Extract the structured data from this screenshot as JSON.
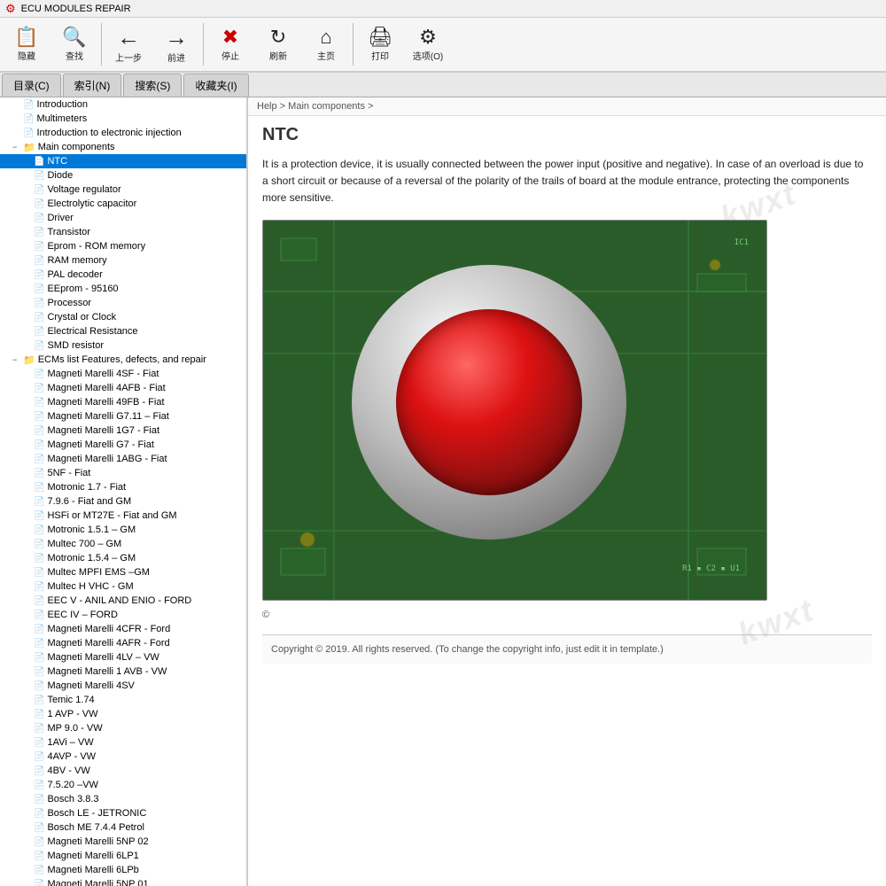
{
  "titleBar": {
    "icon": "⚙",
    "title": "ECU MODULES REPAIR"
  },
  "toolbar": {
    "buttons": [
      {
        "label": "隐藏",
        "icon": "📄",
        "name": "hide-button"
      },
      {
        "label": "查找",
        "icon": "🔍",
        "name": "find-button"
      },
      {
        "label": "上一步",
        "icon": "←",
        "name": "back-button"
      },
      {
        "label": "前进",
        "icon": "→",
        "name": "forward-button"
      },
      {
        "label": "停止",
        "icon": "✖",
        "name": "stop-button"
      },
      {
        "label": "刷新",
        "icon": "🔄",
        "name": "refresh-button"
      },
      {
        "label": "主页",
        "icon": "🏠",
        "name": "home-button"
      },
      {
        "label": "打印",
        "icon": "🖨",
        "name": "print-button"
      },
      {
        "label": "选项(O)",
        "icon": "⚙",
        "name": "options-button"
      }
    ]
  },
  "tabs": [
    {
      "label": "目录(C)",
      "active": false
    },
    {
      "label": "索引(N)",
      "active": false
    },
    {
      "label": "搜索(S)",
      "active": false
    },
    {
      "label": "收藏夹(I)",
      "active": false
    }
  ],
  "breadcrumb": "Help > Main components >",
  "pageTitle": "NTC",
  "contentText": "It is a protection device, it is usually connected between the power input (positive and negative). In case of an overload is due to a short circuit or because of a reversal of the polarity of the trails of board at the module entrance, protecting the components more sensitive.",
  "copyright": "©",
  "footerCopyright": "Copyright © 2019. All rights reserved. (To change the copyright info, just edit it in template.)",
  "watermark": "kwxt",
  "sidebar": {
    "items": [
      {
        "level": 1,
        "label": "Introduction",
        "type": "doc",
        "expand": "",
        "name": "introduction"
      },
      {
        "level": 1,
        "label": "Multimeters",
        "type": "doc",
        "expand": "",
        "name": "multimeters"
      },
      {
        "level": 1,
        "label": "Introduction to electronic injection",
        "type": "doc",
        "expand": "",
        "name": "intro-electronic"
      },
      {
        "level": 1,
        "label": "Main components",
        "type": "folder",
        "expand": "−",
        "name": "main-components"
      },
      {
        "level": 2,
        "label": "NTC",
        "type": "doc",
        "expand": "",
        "name": "ntc",
        "selected": true
      },
      {
        "level": 2,
        "label": "Diode",
        "type": "doc",
        "expand": "",
        "name": "diode"
      },
      {
        "level": 2,
        "label": "Voltage regulator",
        "type": "doc",
        "expand": "",
        "name": "voltage-regulator"
      },
      {
        "level": 2,
        "label": "Electrolytic capacitor",
        "type": "doc",
        "expand": "",
        "name": "electrolytic-capacitor"
      },
      {
        "level": 2,
        "label": "Driver",
        "type": "doc",
        "expand": "",
        "name": "driver"
      },
      {
        "level": 2,
        "label": "Transistor",
        "type": "doc",
        "expand": "",
        "name": "transistor"
      },
      {
        "level": 2,
        "label": "Eprom - ROM memory",
        "type": "doc",
        "expand": "",
        "name": "eprom-rom"
      },
      {
        "level": 2,
        "label": "RAM memory",
        "type": "doc",
        "expand": "",
        "name": "ram-memory"
      },
      {
        "level": 2,
        "label": "PAL decoder",
        "type": "doc",
        "expand": "",
        "name": "pal-decoder"
      },
      {
        "level": 2,
        "label": "EEprom - 95160",
        "type": "doc",
        "expand": "",
        "name": "eeprom-95160"
      },
      {
        "level": 2,
        "label": "Processor",
        "type": "doc",
        "expand": "",
        "name": "processor"
      },
      {
        "level": 2,
        "label": "Crystal or Clock",
        "type": "doc",
        "expand": "",
        "name": "crystal-clock"
      },
      {
        "level": 2,
        "label": "Electrical Resistance",
        "type": "doc",
        "expand": "",
        "name": "electrical-resistance"
      },
      {
        "level": 2,
        "label": "SMD resistor",
        "type": "doc",
        "expand": "",
        "name": "smd-resistor"
      },
      {
        "level": 1,
        "label": "ECMs list Features, defects, and repair",
        "type": "folder",
        "expand": "−",
        "name": "ecms-list"
      },
      {
        "level": 2,
        "label": "Magneti Marelli 4SF - Fiat",
        "type": "doc",
        "expand": "",
        "name": "mm-4sf-fiat"
      },
      {
        "level": 2,
        "label": "Magneti Marelli 4AFB - Fiat",
        "type": "doc",
        "expand": "",
        "name": "mm-4afb"
      },
      {
        "level": 2,
        "label": "Magneti Marelli 49FB - Fiat",
        "type": "doc",
        "expand": "",
        "name": "mm-49fb"
      },
      {
        "level": 2,
        "label": "Magneti Marelli G7.11 – Fiat",
        "type": "doc",
        "expand": "",
        "name": "mm-g711"
      },
      {
        "level": 2,
        "label": "Magneti Marelli 1G7 - Fiat",
        "type": "doc",
        "expand": "",
        "name": "mm-1g7"
      },
      {
        "level": 2,
        "label": "Magneti Marelli G7 - Fiat",
        "type": "doc",
        "expand": "",
        "name": "mm-g7"
      },
      {
        "level": 2,
        "label": "Magneti Marelli 1ABG - Fiat",
        "type": "doc",
        "expand": "",
        "name": "mm-1abg"
      },
      {
        "level": 2,
        "label": "5NF - Fiat",
        "type": "doc",
        "expand": "",
        "name": "5nf-fiat"
      },
      {
        "level": 2,
        "label": "Motronic 1.7 - Fiat",
        "type": "doc",
        "expand": "",
        "name": "motronic-17"
      },
      {
        "level": 2,
        "label": "7.9.6 - Fiat and GM",
        "type": "doc",
        "expand": "",
        "name": "796-fiat-gm"
      },
      {
        "level": 2,
        "label": "HSFi or MT27E - Fiat and GM",
        "type": "doc",
        "expand": "",
        "name": "hsfi-mt27e"
      },
      {
        "level": 2,
        "label": "Motronic 1.5.1 – GM",
        "type": "doc",
        "expand": "",
        "name": "motronic-151"
      },
      {
        "level": 2,
        "label": "Multec 700 – GM",
        "type": "doc",
        "expand": "",
        "name": "multec-700"
      },
      {
        "level": 2,
        "label": "Motronic 1.5.4 – GM",
        "type": "doc",
        "expand": "",
        "name": "motronic-154"
      },
      {
        "level": 2,
        "label": "Multec MPFI EMS –GM",
        "type": "doc",
        "expand": "",
        "name": "multec-mpfi"
      },
      {
        "level": 2,
        "label": "Multec H VHC - GM",
        "type": "doc",
        "expand": "",
        "name": "multec-h-vhc"
      },
      {
        "level": 2,
        "label": "EEC V - ANIL AND ENIO - FORD",
        "type": "doc",
        "expand": "",
        "name": "eec-v"
      },
      {
        "level": 2,
        "label": "EEC IV – FORD",
        "type": "doc",
        "expand": "",
        "name": "eec-iv"
      },
      {
        "level": 2,
        "label": "Magneti Marelli 4CFR - Ford",
        "type": "doc",
        "expand": "",
        "name": "mm-4cfr"
      },
      {
        "level": 2,
        "label": "Magneti Marelli 4AFR - Ford",
        "type": "doc",
        "expand": "",
        "name": "mm-4afr"
      },
      {
        "level": 2,
        "label": "Magneti Marelli 4LV – VW",
        "type": "doc",
        "expand": "",
        "name": "mm-4lv"
      },
      {
        "level": 2,
        "label": "Magneti Marelli 1 AVB - VW",
        "type": "doc",
        "expand": "",
        "name": "mm-1avb"
      },
      {
        "level": 2,
        "label": "Magneti Marelli 4SV",
        "type": "doc",
        "expand": "",
        "name": "mm-4sv"
      },
      {
        "level": 2,
        "label": "Temic 1.74",
        "type": "doc",
        "expand": "",
        "name": "temic-174"
      },
      {
        "level": 2,
        "label": "1 AVP - VW",
        "type": "doc",
        "expand": "",
        "name": "1avp-vw"
      },
      {
        "level": 2,
        "label": "MP 9.0 - VW",
        "type": "doc",
        "expand": "",
        "name": "mp90-vw"
      },
      {
        "level": 2,
        "label": "1AVi – VW",
        "type": "doc",
        "expand": "",
        "name": "1avi-vw"
      },
      {
        "level": 2,
        "label": "4AVP - VW",
        "type": "doc",
        "expand": "",
        "name": "4avp-vw"
      },
      {
        "level": 2,
        "label": "4BV - VW",
        "type": "doc",
        "expand": "",
        "name": "4bv-vw"
      },
      {
        "level": 2,
        "label": "7.5.20 –VW",
        "type": "doc",
        "expand": "",
        "name": "7520-vw"
      },
      {
        "level": 2,
        "label": "Bosch 3.8.3",
        "type": "doc",
        "expand": "",
        "name": "bosch-383"
      },
      {
        "level": 2,
        "label": "Bosch LE - JETRONIC",
        "type": "doc",
        "expand": "",
        "name": "bosch-le"
      },
      {
        "level": 2,
        "label": "Bosch ME 7.4.4 Petrol",
        "type": "doc",
        "expand": "",
        "name": "bosch-me744"
      },
      {
        "level": 2,
        "label": "Magneti Marelli 5NP 02",
        "type": "doc",
        "expand": "",
        "name": "mm-5np02"
      },
      {
        "level": 2,
        "label": "Magneti Marelli 6LP1",
        "type": "doc",
        "expand": "",
        "name": "mm-6lp1"
      },
      {
        "level": 2,
        "label": "Magneti Marelli 6LPb",
        "type": "doc",
        "expand": "",
        "name": "mm-6lpb"
      },
      {
        "level": 2,
        "label": "Magneti Marelli 5NP 01",
        "type": "doc",
        "expand": "",
        "name": "mm-5np01"
      }
    ]
  }
}
